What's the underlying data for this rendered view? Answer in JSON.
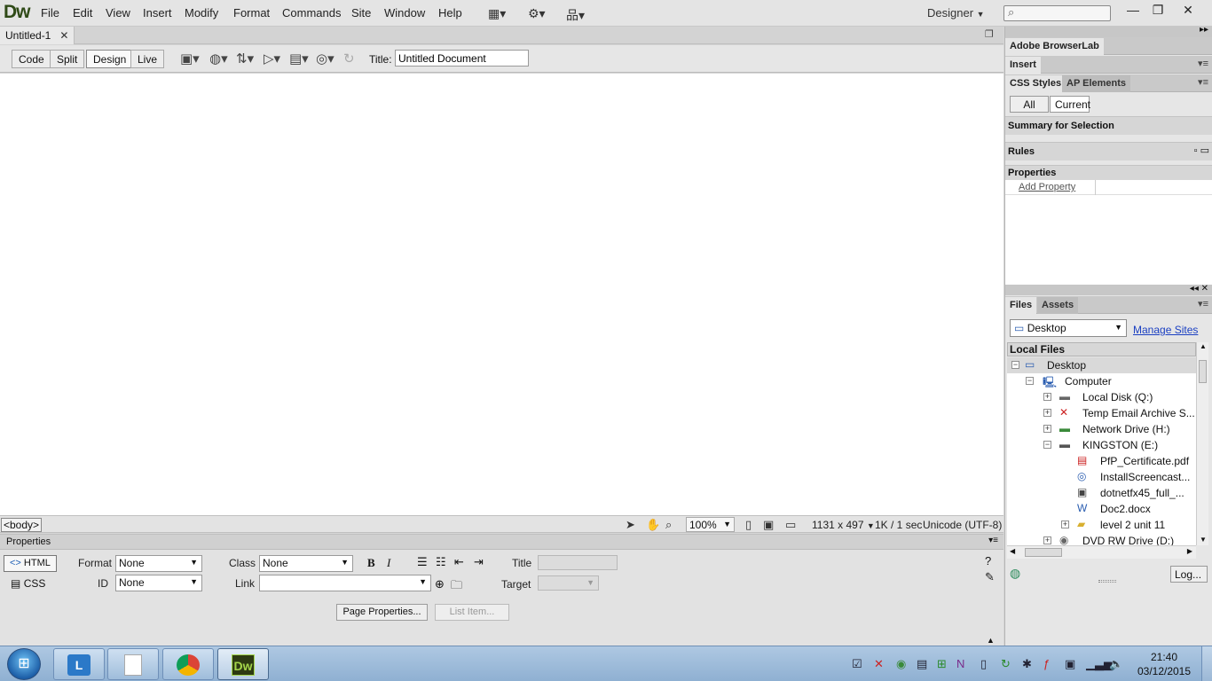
{
  "app": {
    "logo": "Dw",
    "workspace": "Designer"
  },
  "menu": [
    "File",
    "Edit",
    "View",
    "Insert",
    "Modify",
    "Format",
    "Commands",
    "Site",
    "Window",
    "Help"
  ],
  "document": {
    "tab_name": "Untitled-1",
    "title_label": "Title:",
    "title_value": "Untitled Document"
  },
  "view_buttons": [
    "Code",
    "Split",
    "Design",
    "Live"
  ],
  "status": {
    "tag": "<body>",
    "zoom": "100%",
    "dimensions": "1131 x 497",
    "size_time": "1K / 1 sec",
    "encoding": "Unicode (UTF-8)"
  },
  "properties": {
    "header": "Properties",
    "html_btn": "HTML",
    "css_btn": "CSS",
    "format_label": "Format",
    "format_value": "None",
    "class_label": "Class",
    "class_value": "None",
    "id_label": "ID",
    "id_value": "None",
    "link_label": "Link",
    "title_label": "Title",
    "target_label": "Target",
    "page_properties_btn": "Page Properties...",
    "list_item_btn": "List Item..."
  },
  "panels": {
    "browserlab": "Adobe BrowserLab",
    "insert": "Insert",
    "css_tab": "CSS Styles",
    "ap_tab": "AP Elements",
    "all_btn": "All",
    "current_btn": "Current",
    "summary": "Summary for Selection",
    "rules": "Rules",
    "properties": "Properties",
    "add_property": "Add Property",
    "files_tab": "Files",
    "assets_tab": "Assets",
    "site": "Desktop",
    "manage_sites": "Manage Sites",
    "local_files": "Local Files",
    "log_btn": "Log..."
  },
  "tree": [
    {
      "label": "Desktop"
    },
    {
      "label": "Computer"
    },
    {
      "label": "Local Disk (Q:)"
    },
    {
      "label": "Temp Email Archive S..."
    },
    {
      "label": "Network Drive (H:)"
    },
    {
      "label": "KINGSTON (E:)"
    },
    {
      "label": "PfP_Certificate.pdf"
    },
    {
      "label": "InstallScreencast..."
    },
    {
      "label": "dotnetfx45_full_..."
    },
    {
      "label": "Doc2.docx"
    },
    {
      "label": "level 2 unit 11"
    },
    {
      "label": "DVD RW Drive (D:)"
    }
  ],
  "taskbar": {
    "time": "21:40",
    "date": "03/12/2015"
  }
}
